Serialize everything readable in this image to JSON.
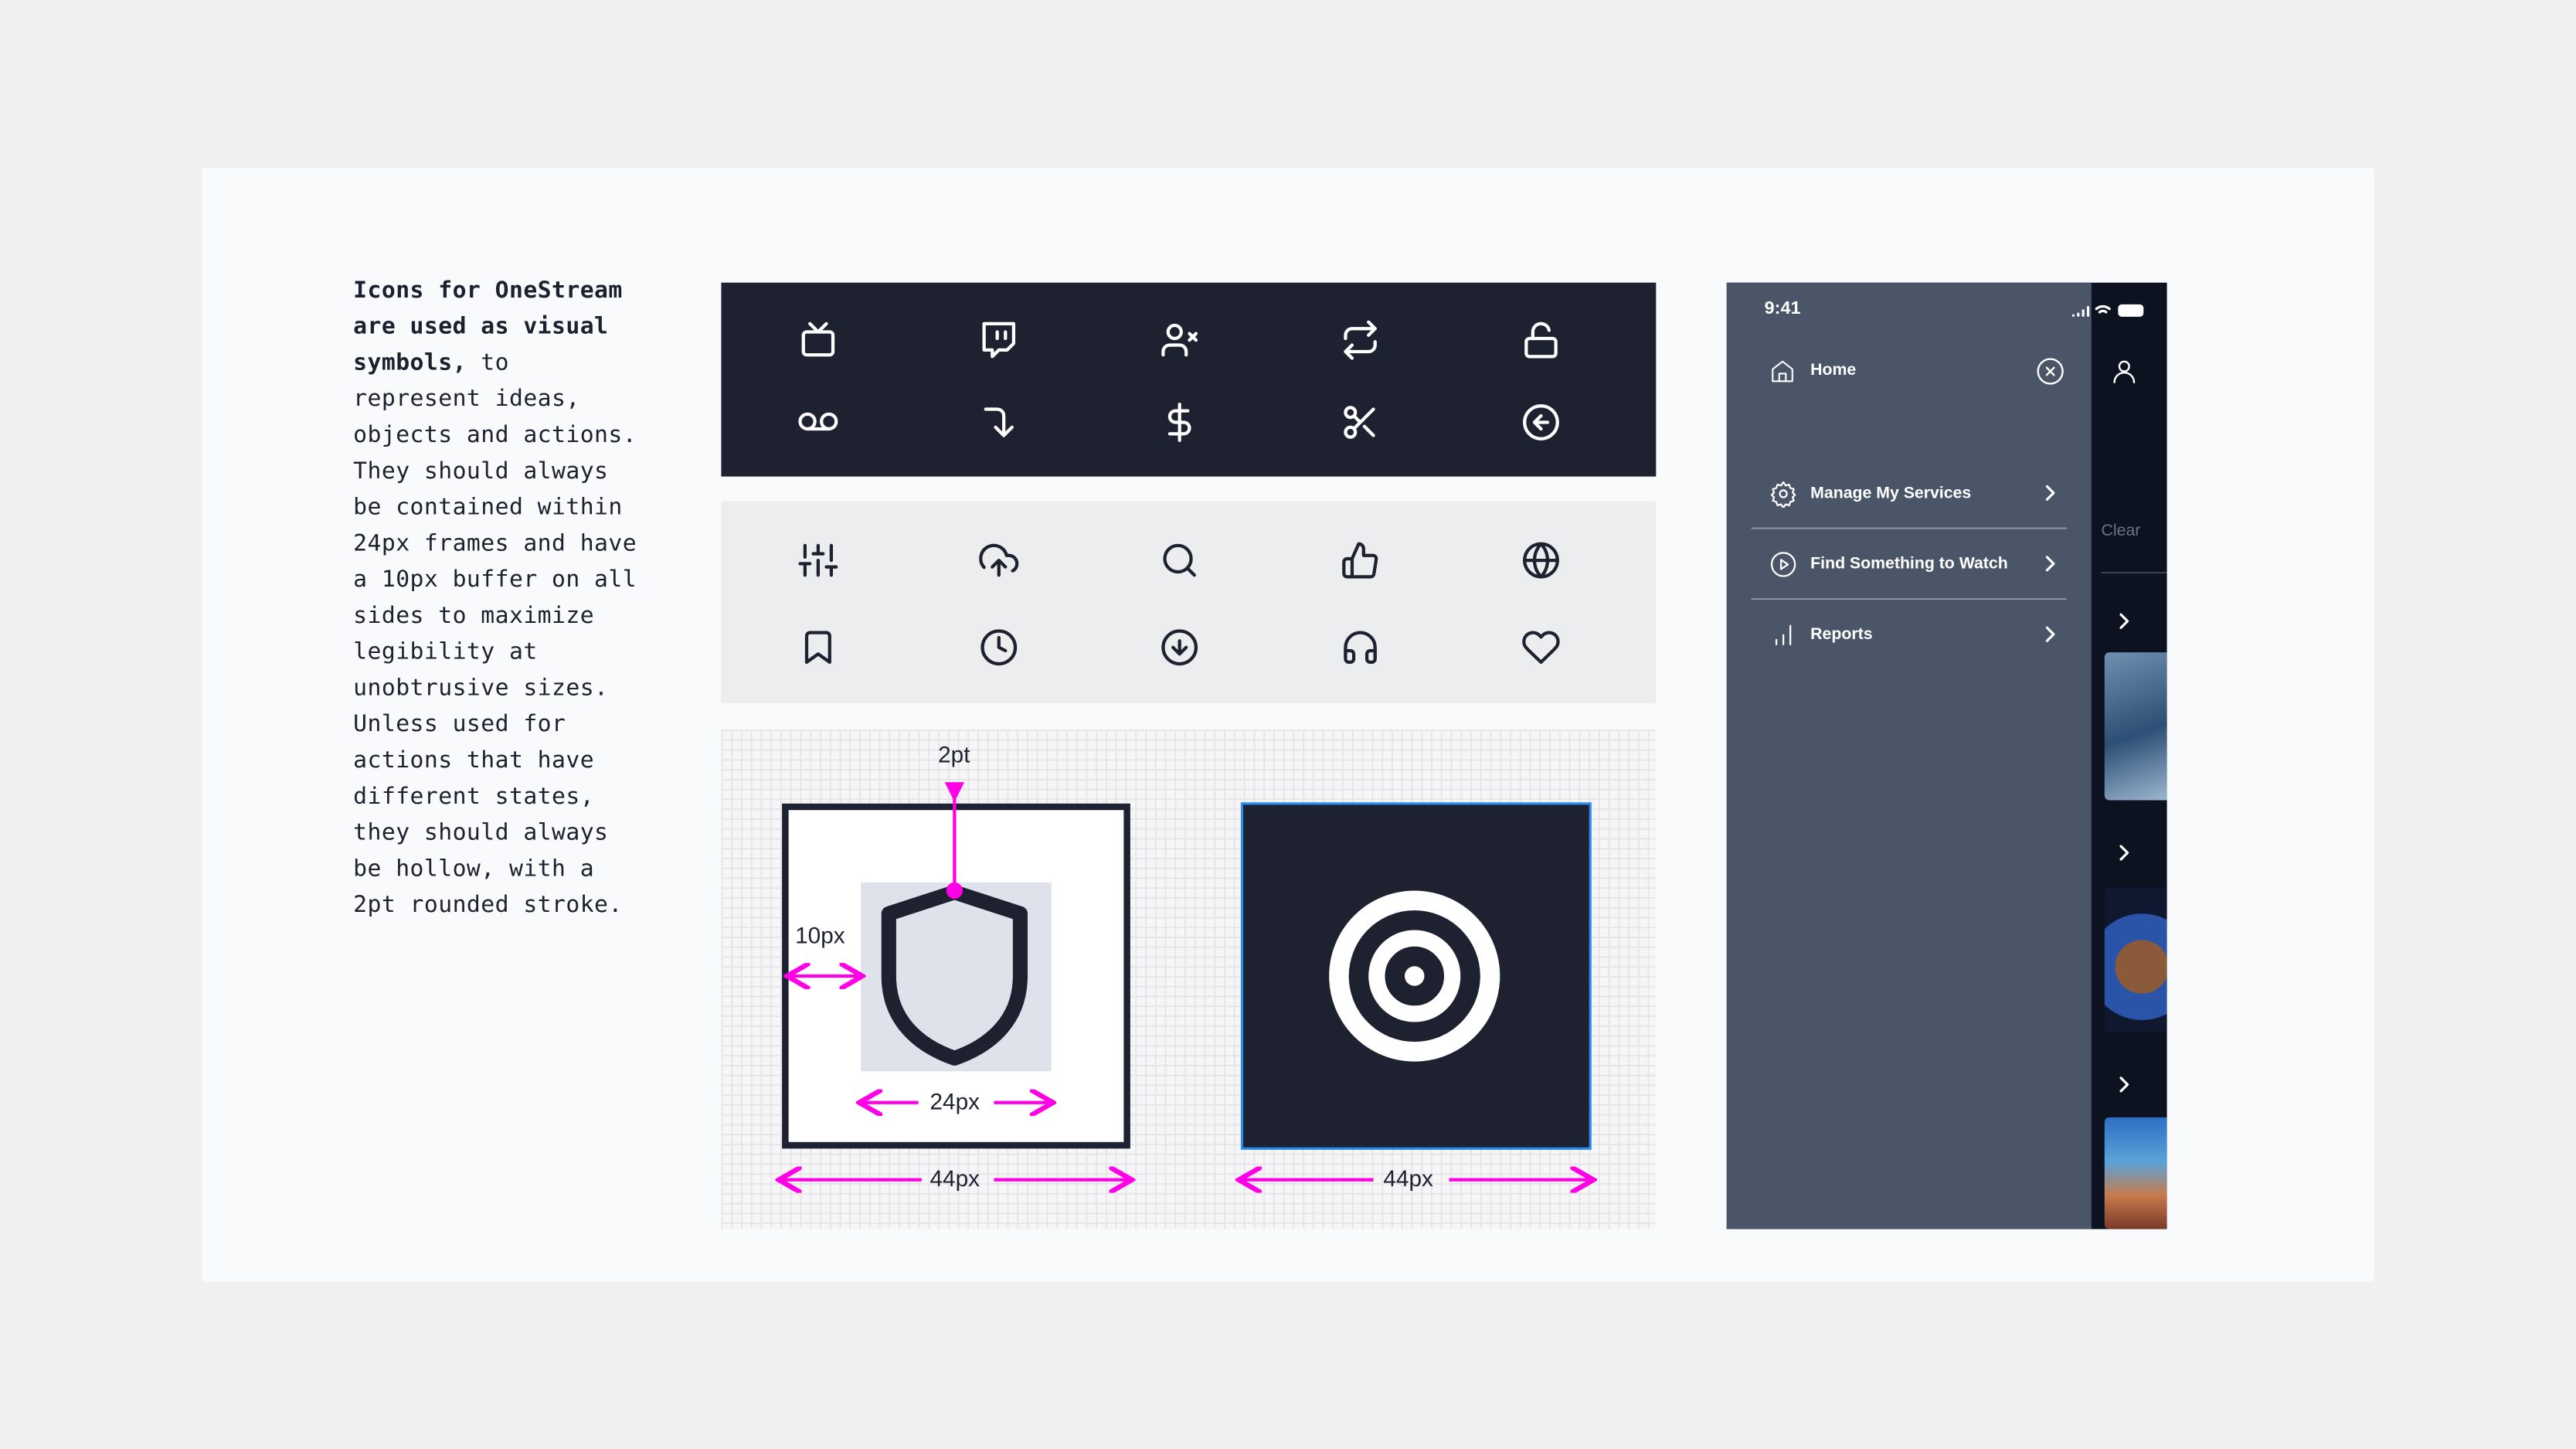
{
  "intro": {
    "bold": "Icons for OneStream are used as visual symbols,",
    "rest": " to represent ideas, objects and actions. They should always be contained within 24px frames and have a 10px buffer on all sides to maximize legibility at unobtrusive sizes. Unless used for actions that have different states, they should always be hollow, with a 2pt rounded stroke."
  },
  "icons_dark": [
    "tv-icon",
    "twitch-icon",
    "user-x-icon",
    "repeat-icon",
    "unlock-icon",
    "voicemail-icon",
    "corner-right-down-icon",
    "dollar-icon",
    "scissors-icon",
    "arrow-left-circle-icon"
  ],
  "icons_light": [
    "sliders-icon",
    "upload-cloud-icon",
    "search-icon",
    "thumbs-up-icon",
    "globe-icon",
    "bookmark-icon",
    "clock-icon",
    "download-circle-icon",
    "headphones-icon",
    "heart-icon"
  ],
  "diagram": {
    "stroke_label": "2pt",
    "buffer_label": "10px",
    "icon_label": "24px",
    "frame_label": "44px",
    "frame_label_2": "44px"
  },
  "phone": {
    "time": "9:41",
    "home": "Home",
    "menu": [
      "Manage My Services",
      "Find Something to Watch",
      "Reports"
    ],
    "clear": "Clear"
  },
  "colors": {
    "accent": "#ff00e6",
    "dark": "#1d2130",
    "drawer": "#4a5568"
  }
}
